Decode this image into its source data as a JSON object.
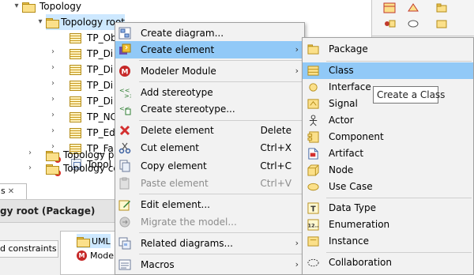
{
  "tree": {
    "rows": [
      {
        "label": "Topology"
      },
      {
        "label": "Topology root"
      },
      {
        "label": "TP_Ob"
      },
      {
        "label": "TP_Di"
      },
      {
        "label": "TP_Di"
      },
      {
        "label": "TP_Di"
      },
      {
        "label": "TP_Di"
      },
      {
        "label": "TP_NC"
      },
      {
        "label": "TP_Ed"
      },
      {
        "label": "TP_Fa"
      },
      {
        "label": "Topol"
      },
      {
        "label": "Topology pr"
      },
      {
        "label": "Topology cc"
      }
    ]
  },
  "properties": {
    "tab_label": "s",
    "tab_close": "✕",
    "title": "gy root (Package)",
    "constraints_label": "d constraints",
    "list": [
      {
        "label": "UML"
      },
      {
        "label": "Mode"
      }
    ]
  },
  "context_menu": {
    "items": [
      {
        "label": "Create diagram...",
        "icon": "create-diagram-icon"
      },
      {
        "label": "Create element",
        "icon": "create-element-icon",
        "arrow": "›"
      },
      {
        "label": "Modeler Module",
        "icon": "modeler-module-icon",
        "arrow": "›"
      },
      {
        "label": "Add stereotype",
        "icon": "add-stereotype-icon"
      },
      {
        "label": "Create stereotype...",
        "icon": "create-stereotype-icon"
      },
      {
        "label": "Delete element",
        "icon": "delete-icon",
        "shortcut": "Delete"
      },
      {
        "label": "Cut element",
        "icon": "cut-icon",
        "shortcut": "Ctrl+X"
      },
      {
        "label": "Copy element",
        "icon": "copy-icon",
        "shortcut": "Ctrl+C"
      },
      {
        "label": "Paste element",
        "icon": "paste-icon",
        "shortcut": "Ctrl+V"
      },
      {
        "label": "Edit element...",
        "icon": "edit-icon"
      },
      {
        "label": "Migrate the model...",
        "icon": "migrate-icon"
      },
      {
        "label": "Related diagrams...",
        "icon": "related-diagrams-icon",
        "arrow": "›"
      },
      {
        "label": "Macros",
        "icon": "macros-icon",
        "arrow": "›"
      }
    ]
  },
  "submenu": {
    "items": [
      {
        "label": "Package",
        "icon": "package-icon"
      },
      {
        "label": "Class",
        "icon": "class-icon"
      },
      {
        "label": "Interface",
        "icon": "interface-icon"
      },
      {
        "label": "Signal",
        "icon": "signal-icon"
      },
      {
        "label": "Actor",
        "icon": "actor-icon"
      },
      {
        "label": "Component",
        "icon": "component-icon"
      },
      {
        "label": "Artifact",
        "icon": "artifact-icon"
      },
      {
        "label": "Node",
        "icon": "node-icon"
      },
      {
        "label": "Use Case",
        "icon": "use-case-icon"
      },
      {
        "label": "Data Type",
        "icon": "data-type-icon"
      },
      {
        "label": "Enumeration",
        "icon": "enumeration-icon"
      },
      {
        "label": "Instance",
        "icon": "instance-icon"
      },
      {
        "label": "Collaboration",
        "icon": "collaboration-icon"
      }
    ]
  },
  "tooltip": {
    "text": "Create a Class"
  },
  "colors": {
    "highlight": "#91c9f7",
    "tree_selection": "#cde8ff",
    "menu_background": "#f2f2f2",
    "disabled_text": "#8c8c8c"
  }
}
